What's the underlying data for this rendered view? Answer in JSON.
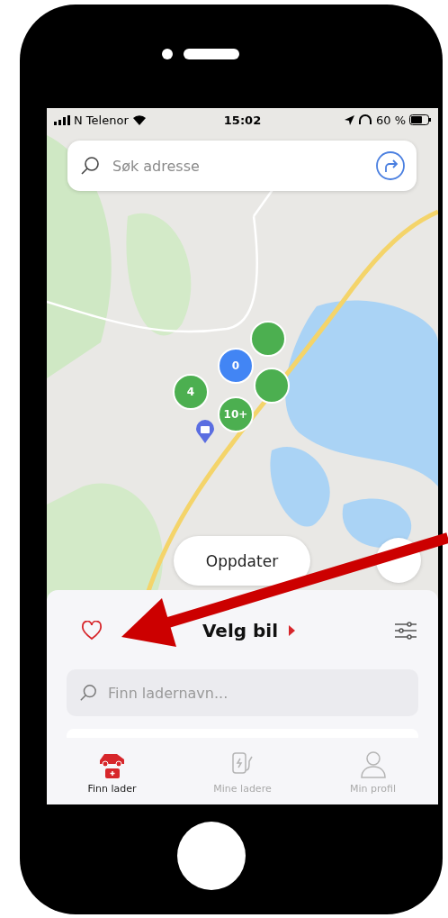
{
  "status_bar": {
    "carrier": "N Telenor",
    "time": "15:02",
    "battery": "60 %"
  },
  "search": {
    "placeholder": "Søk adresse"
  },
  "map": {
    "markers": [
      {
        "color": "#4caf50"
      },
      {
        "label": "4",
        "color": "#4caf50"
      },
      {
        "color": "#4caf50"
      },
      {
        "label": "0",
        "color": "#4285f4"
      },
      {
        "label": "10+",
        "color": "#4caf50"
      }
    ]
  },
  "refresh_button": "Oppdater",
  "sheet": {
    "title": "Velg bil",
    "search_placeholder": "Finn ladernavn..."
  },
  "tabs": [
    {
      "label": "Finn lader",
      "selected": true
    },
    {
      "label": "Mine ladere",
      "selected": false
    },
    {
      "label": "Min profil",
      "selected": false
    }
  ]
}
